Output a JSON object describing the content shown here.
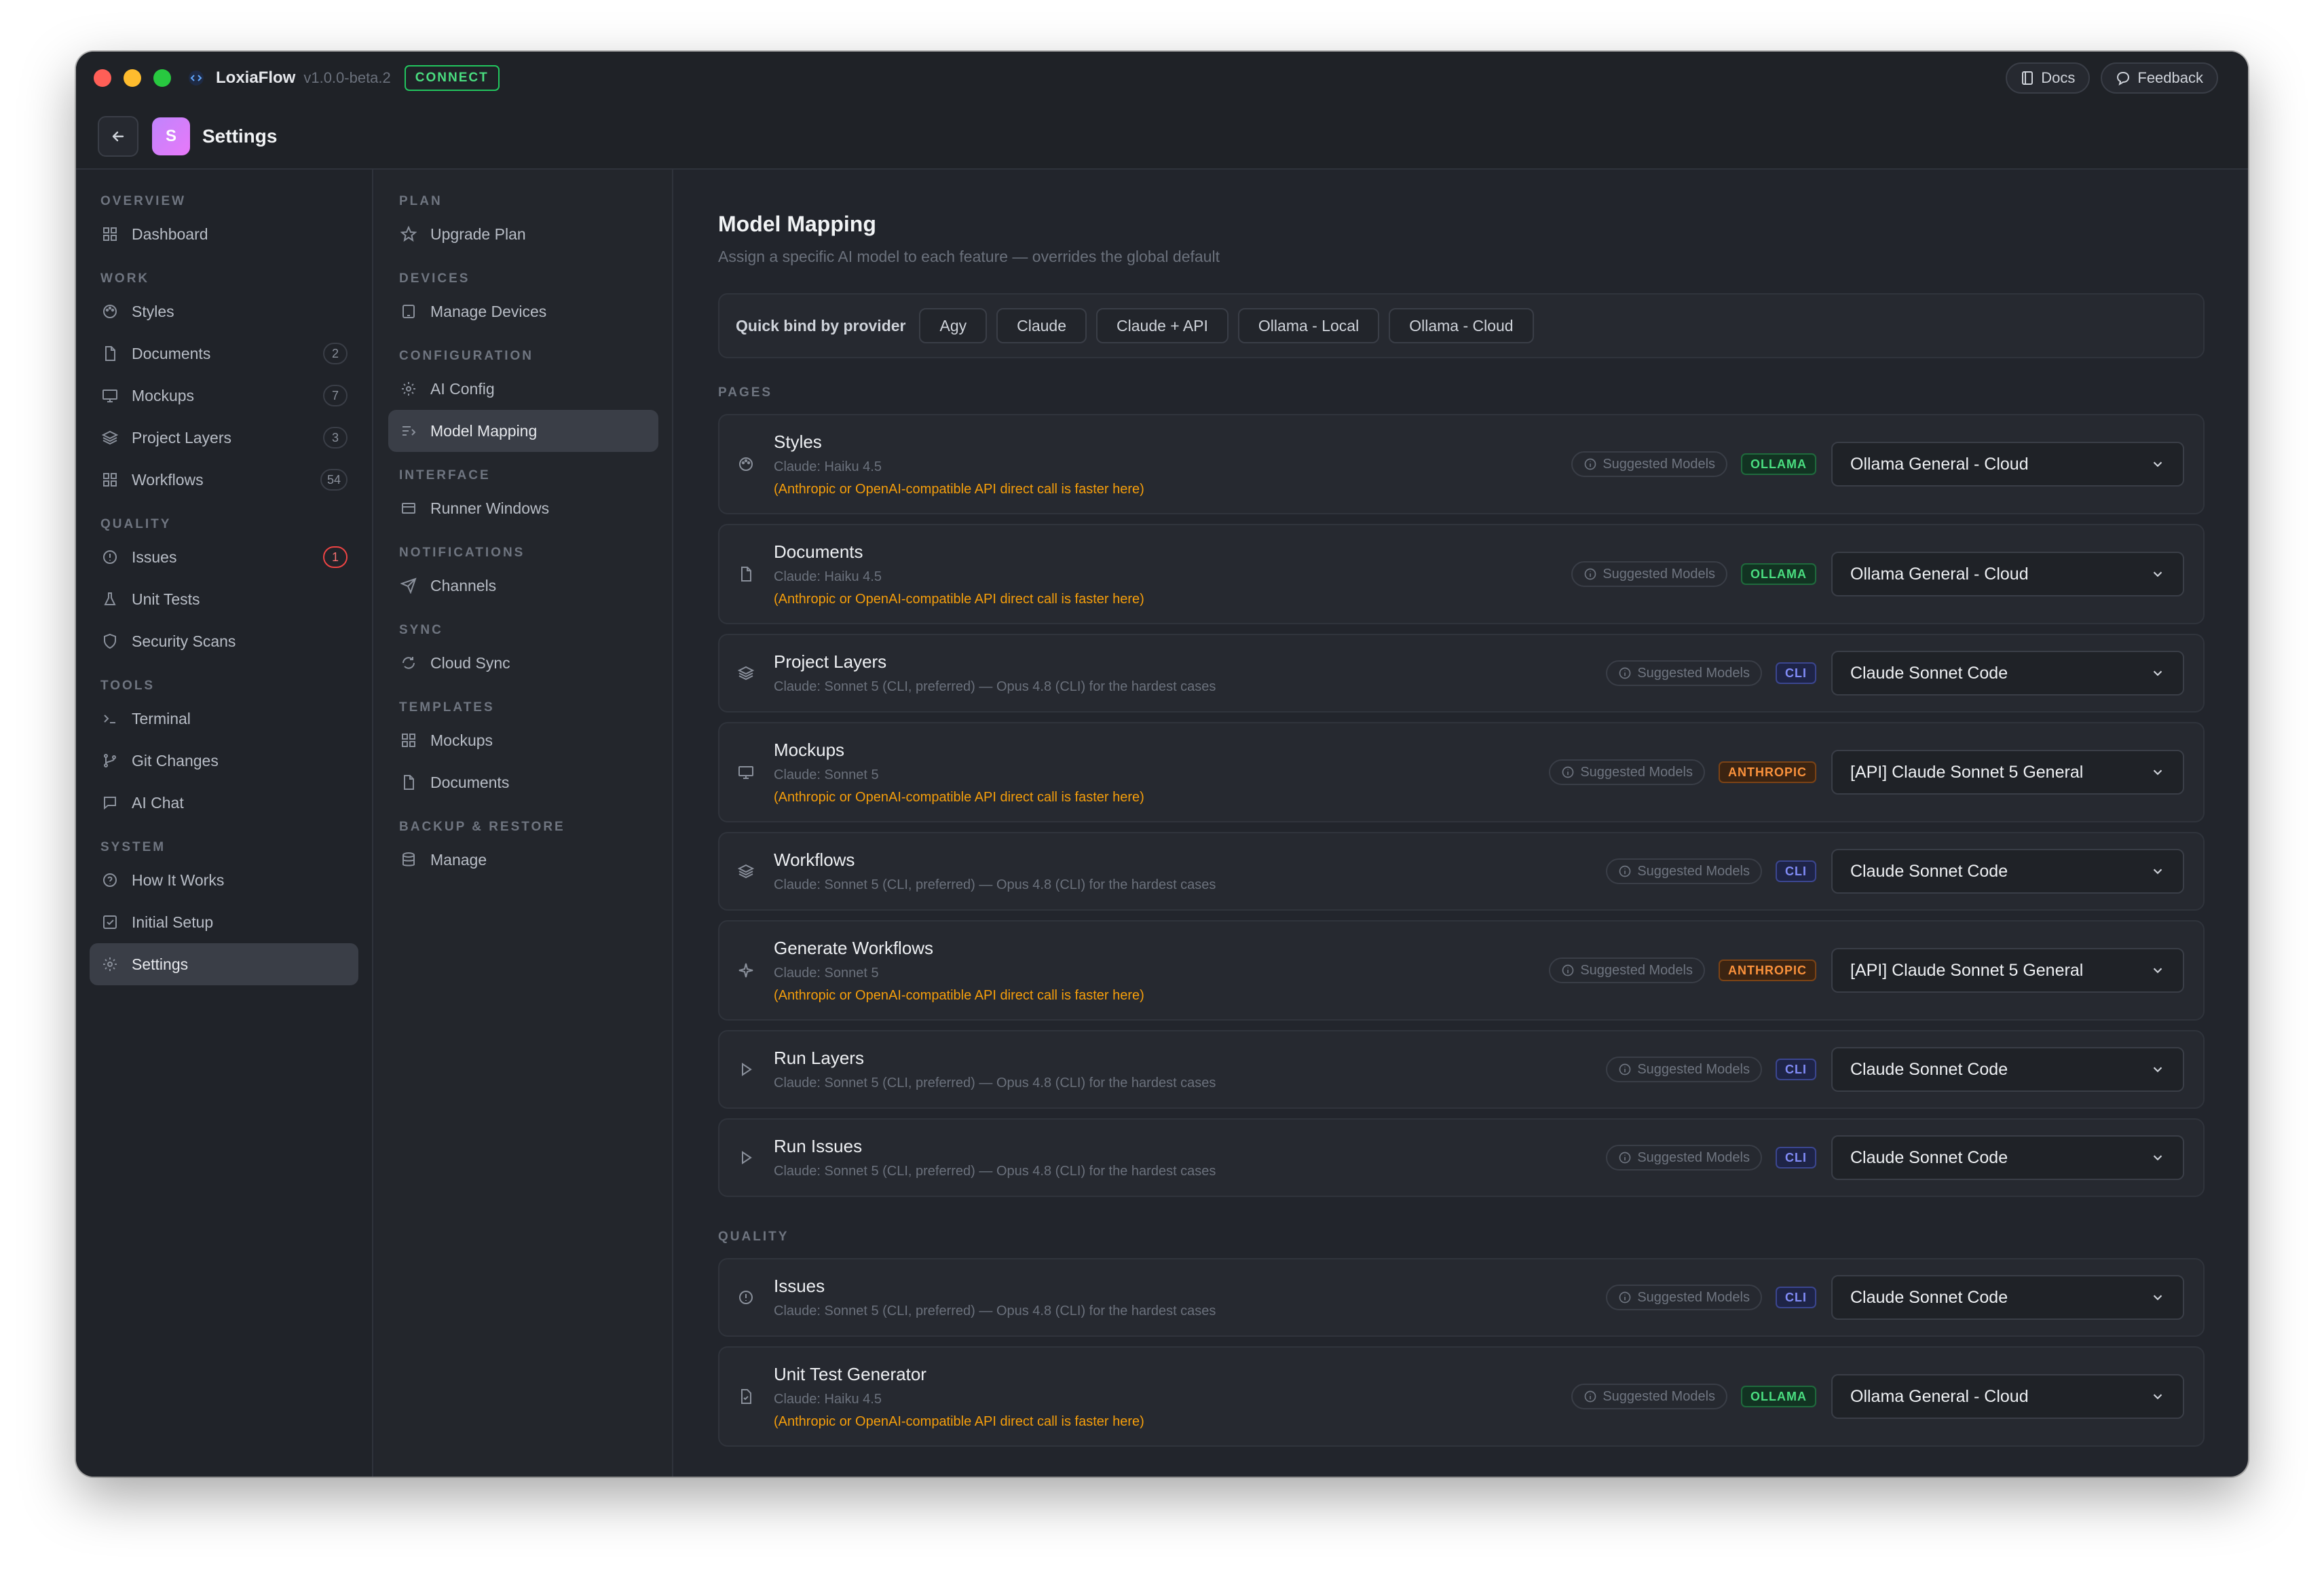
{
  "window": {
    "app_name": "LoxiaFlow",
    "app_version": "v1.0.0-beta.2",
    "connect_label": "CONNECT",
    "docs_label": "Docs",
    "feedback_label": "Feedback",
    "traffic_colors": [
      "#ff5f57",
      "#febc2e",
      "#28c840"
    ]
  },
  "header": {
    "avatar_letter": "S",
    "title": "Settings"
  },
  "sidebar": {
    "sections": [
      {
        "label": "OVERVIEW",
        "items": [
          {
            "label": "Dashboard",
            "icon": "grid-icon"
          }
        ]
      },
      {
        "label": "WORK",
        "items": [
          {
            "label": "Styles",
            "icon": "palette-icon"
          },
          {
            "label": "Documents",
            "icon": "file-icon",
            "badge": "2"
          },
          {
            "label": "Mockups",
            "icon": "monitor-icon",
            "badge": "7"
          },
          {
            "label": "Project Layers",
            "icon": "layers-icon",
            "badge": "3"
          },
          {
            "label": "Workflows",
            "icon": "grid-icon",
            "badge": "54"
          }
        ]
      },
      {
        "label": "QUALITY",
        "items": [
          {
            "label": "Issues",
            "icon": "alert-circle-icon",
            "badge": "1"
          },
          {
            "label": "Unit Tests",
            "icon": "flask-icon"
          },
          {
            "label": "Security Scans",
            "icon": "shield-icon"
          }
        ]
      },
      {
        "label": "TOOLS",
        "items": [
          {
            "label": "Terminal",
            "icon": "terminal-icon"
          },
          {
            "label": "Git Changes",
            "icon": "git-branch-icon"
          },
          {
            "label": "AI Chat",
            "icon": "chat-icon"
          }
        ]
      },
      {
        "label": "SYSTEM",
        "items": [
          {
            "label": "How It Works",
            "icon": "help-circle-icon"
          },
          {
            "label": "Initial Setup",
            "icon": "checkbox-icon"
          },
          {
            "label": "Settings",
            "icon": "gear-icon"
          }
        ]
      }
    ]
  },
  "subnav": {
    "sections": [
      {
        "label": "PLAN",
        "items": [
          {
            "label": "Upgrade Plan",
            "icon": "star-icon"
          }
        ]
      },
      {
        "label": "DEVICES",
        "items": [
          {
            "label": "Manage Devices",
            "icon": "device-icon"
          }
        ]
      },
      {
        "label": "CONFIGURATION",
        "items": [
          {
            "label": "AI Config",
            "icon": "sun-icon"
          },
          {
            "label": "Model Mapping",
            "icon": "mapping-icon"
          }
        ]
      },
      {
        "label": "INTERFACE",
        "items": [
          {
            "label": "Runner Windows",
            "icon": "window-icon"
          }
        ]
      },
      {
        "label": "NOTIFICATIONS",
        "items": [
          {
            "label": "Channels",
            "icon": "send-icon"
          }
        ]
      },
      {
        "label": "SYNC",
        "items": [
          {
            "label": "Cloud Sync",
            "icon": "sync-icon"
          }
        ]
      },
      {
        "label": "TEMPLATES",
        "items": [
          {
            "label": "Mockups",
            "icon": "grid-icon"
          },
          {
            "label": "Documents",
            "icon": "file-icon"
          }
        ]
      },
      {
        "label": "BACKUP & RESTORE",
        "items": [
          {
            "label": "Manage",
            "icon": "database-icon"
          }
        ]
      }
    ]
  },
  "main": {
    "title": "Model Mapping",
    "subtitle": "Assign a specific AI model to each feature — overrides the global default",
    "quick_bind": {
      "label": "Quick bind by provider",
      "providers": [
        "Agy",
        "Claude",
        "Claude + API",
        "Ollama - Local",
        "Ollama - Cloud"
      ]
    },
    "suggested_label": "Suggested Models",
    "pages_label": "PAGES",
    "quality_label": "QUALITY",
    "pages": [
      {
        "title": "Styles",
        "sub": "Claude: Haiku 4.5",
        "warn": "(Anthropic or OpenAI-compatible API direct call is faster here)",
        "tag": "OLLAMA",
        "model": "Ollama General - Cloud",
        "icon": "palette-icon"
      },
      {
        "title": "Documents",
        "sub": "Claude: Haiku 4.5",
        "warn": "(Anthropic or OpenAI-compatible API direct call is faster here)",
        "tag": "OLLAMA",
        "model": "Ollama General - Cloud",
        "icon": "file-icon"
      },
      {
        "title": "Project Layers",
        "sub": "Claude: Sonnet 5 (CLI, preferred) — Opus 4.8 (CLI) for the hardest cases",
        "tag": "CLI",
        "model": "Claude Sonnet Code",
        "icon": "layers-icon"
      },
      {
        "title": "Mockups",
        "sub": "Claude: Sonnet 5",
        "warn": "(Anthropic or OpenAI-compatible API direct call is faster here)",
        "tag": "ANTHROPIC",
        "model": "[API] Claude Sonnet 5 General",
        "icon": "monitor-icon"
      },
      {
        "title": "Workflows",
        "sub": "Claude: Sonnet 5 (CLI, preferred) — Opus 4.8 (CLI) for the hardest cases",
        "tag": "CLI",
        "model": "Claude Sonnet Code",
        "icon": "layers-icon"
      },
      {
        "title": "Generate Workflows",
        "sub": "Claude: Sonnet 5",
        "warn": "(Anthropic or OpenAI-compatible API direct call is faster here)",
        "tag": "ANTHROPIC",
        "model": "[API] Claude Sonnet 5 General",
        "icon": "sparkle-icon"
      },
      {
        "title": "Run Layers",
        "sub": "Claude: Sonnet 5 (CLI, preferred) — Opus 4.8 (CLI) for the hardest cases",
        "tag": "CLI",
        "model": "Claude Sonnet Code",
        "icon": "play-icon"
      },
      {
        "title": "Run Issues",
        "sub": "Claude: Sonnet 5 (CLI, preferred) — Opus 4.8 (CLI) for the hardest cases",
        "tag": "CLI",
        "model": "Claude Sonnet Code",
        "icon": "play-icon"
      }
    ],
    "quality": [
      {
        "title": "Issues",
        "sub": "Claude: Sonnet 5 (CLI, preferred) — Opus 4.8 (CLI) for the hardest cases",
        "tag": "CLI",
        "model": "Claude Sonnet Code",
        "icon": "alert-circle-icon"
      },
      {
        "title": "Unit Test Generator",
        "sub": "Claude: Haiku 4.5",
        "warn": "(Anthropic or OpenAI-compatible API direct call is faster here)",
        "tag": "OLLAMA",
        "model": "Ollama General - Cloud",
        "icon": "file-check-icon"
      }
    ]
  }
}
